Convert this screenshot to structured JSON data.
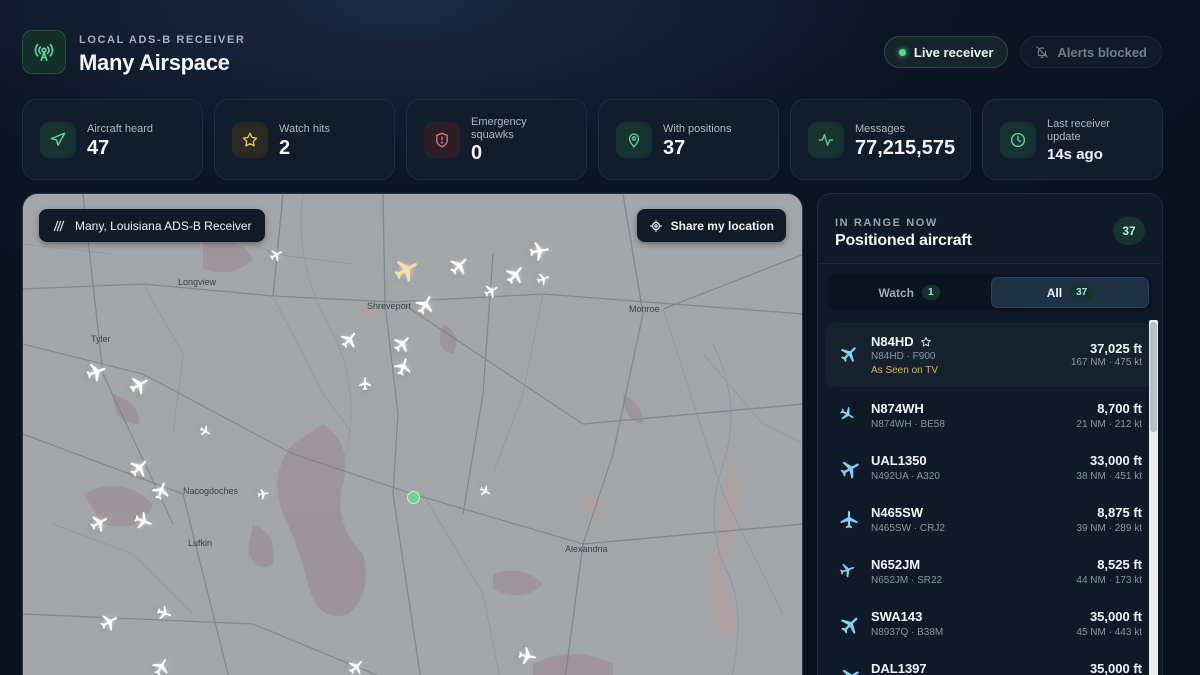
{
  "header": {
    "eyebrow": "LOCAL ADS-B RECEIVER",
    "title": "Many Airspace",
    "live_label": "Live receiver",
    "alerts_label": "Alerts blocked"
  },
  "stats": [
    {
      "label": "Aircraft heard",
      "value": "47",
      "icon": "plane-icon"
    },
    {
      "label": "Watch hits",
      "value": "2",
      "icon": "star-icon"
    },
    {
      "label": "Emergency squawks",
      "value": "0",
      "icon": "shield-alert-icon"
    },
    {
      "label": "With positions",
      "value": "37",
      "icon": "map-pin-icon"
    },
    {
      "label": "Messages",
      "value": "77,215,575",
      "icon": "activity-icon"
    },
    {
      "label": "Last receiver update",
      "value": "14s ago",
      "icon": "clock-icon"
    }
  ],
  "map": {
    "location_label": "Many, Louisiana ADS-B Receiver",
    "share_label": "Share my location",
    "cities": [
      "Shreveport",
      "Longview",
      "Tyler",
      "Monroe",
      "Nacogdoches",
      "Lufkin",
      "Alexandria"
    ]
  },
  "panel": {
    "eyebrow": "IN RANGE NOW",
    "title": "Positioned aircraft",
    "count": "37",
    "tabs": [
      {
        "label": "Watch",
        "count": "1"
      },
      {
        "label": "All",
        "count": "37"
      }
    ],
    "aircraft": [
      {
        "callsign": "N84HD",
        "sub": "N84HD · F900",
        "tag": "As Seen on TV",
        "alt": "37,025 ft",
        "dist": "167 NM · 475 kt"
      },
      {
        "callsign": "N874WH",
        "sub": "N874WH · BE58",
        "alt": "8,700 ft",
        "dist": "21 NM · 212 kt"
      },
      {
        "callsign": "UAL1350",
        "sub": "N492UA · A320",
        "alt": "33,000 ft",
        "dist": "38 NM · 451 kt"
      },
      {
        "callsign": "N465SW",
        "sub": "N465SW · CRJ2",
        "alt": "8,875 ft",
        "dist": "39 NM · 289 kt"
      },
      {
        "callsign": "N652JM",
        "sub": "N652JM · SR22",
        "alt": "8,525 ft",
        "dist": "44 NM · 173 kt"
      },
      {
        "callsign": "SWA143",
        "sub": "N8937Q · B38M",
        "alt": "35,000 ft",
        "dist": "45 NM · 443 kt"
      },
      {
        "callsign": "DAL1397",
        "sub": "",
        "alt": "35,000 ft",
        "dist": ""
      }
    ]
  },
  "colors": {
    "accent_green": "#4ee08e",
    "watch_gold": "#d9b64f",
    "background": "#0d1626"
  }
}
